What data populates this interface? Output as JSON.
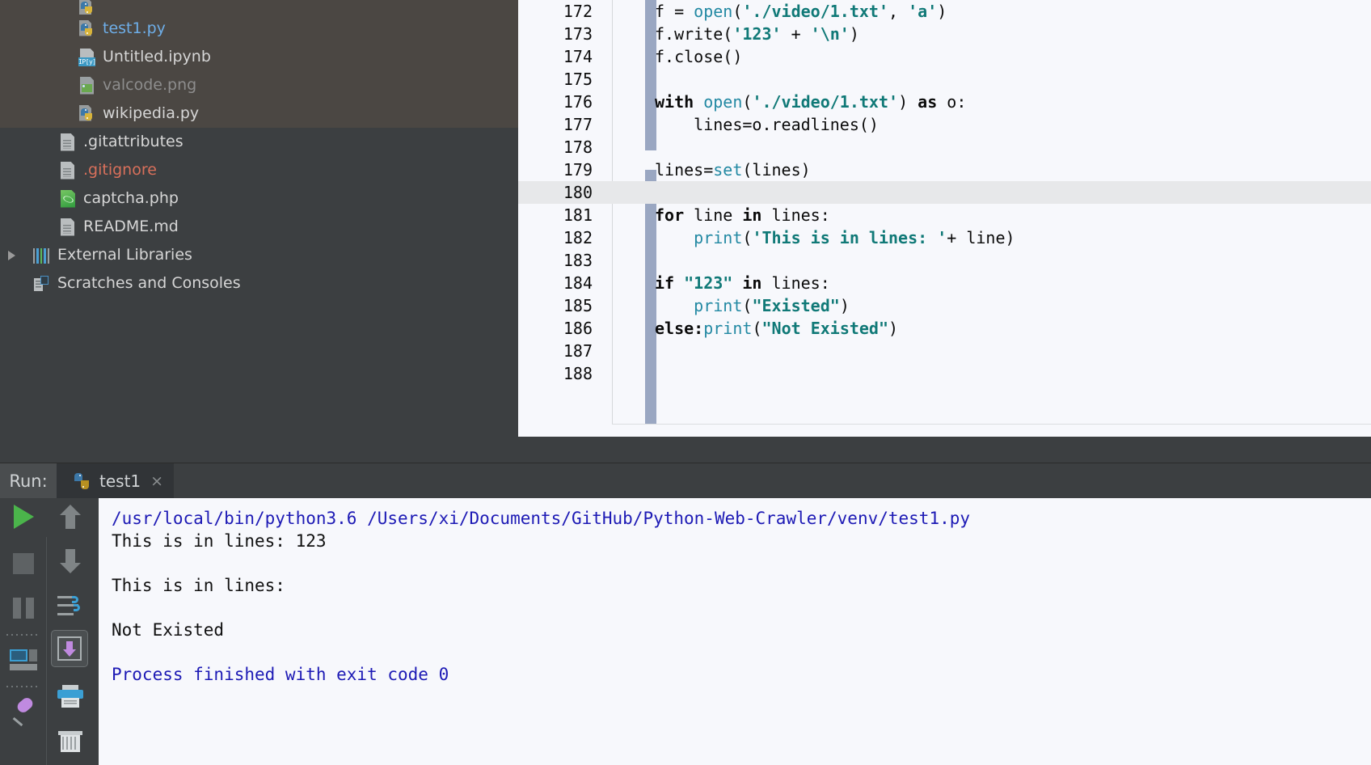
{
  "project_tree": {
    "items": [
      {
        "label": "",
        "icon": "python-file-icon",
        "state": "partial-top",
        "color": "#d6d6d6",
        "highlighted": true
      },
      {
        "label": "test1.py",
        "icon": "python-file-icon",
        "state": "normal",
        "color": "#6eaee8",
        "highlighted": true
      },
      {
        "label": "Untitled.ipynb",
        "icon": "jupyter-notebook-icon",
        "state": "normal",
        "color": "#d6d6d6",
        "highlighted": true
      },
      {
        "label": "valcode.png",
        "icon": "image-file-icon",
        "state": "dimmed",
        "color": "#8d8d8d",
        "highlighted": true
      },
      {
        "label": "wikipedia.py",
        "icon": "python-file-icon",
        "state": "normal",
        "color": "#d6d6d6",
        "highlighted": true
      },
      {
        "label": ".gitattributes",
        "icon": "text-file-icon",
        "state": "normal",
        "color": "#d6d6d6",
        "highlighted": false
      },
      {
        "label": ".gitignore",
        "icon": "text-file-icon",
        "state": "ignored",
        "color": "#d9705b",
        "highlighted": false
      },
      {
        "label": "captcha.php",
        "icon": "php-file-icon",
        "state": "normal",
        "color": "#d6d6d6",
        "highlighted": false
      },
      {
        "label": "README.md",
        "icon": "text-file-icon",
        "state": "normal",
        "color": "#d6d6d6",
        "highlighted": false
      },
      {
        "label": "External Libraries",
        "icon": "libraries-icon",
        "state": "collapsed-node",
        "color": "#d6d6d6",
        "highlighted": false
      },
      {
        "label": "Scratches and Consoles",
        "icon": "scratches-icon",
        "state": "node",
        "color": "#d6d6d6",
        "highlighted": false
      }
    ]
  },
  "editor": {
    "current_line": 180,
    "first_line": 172,
    "last_line": 188,
    "lines": [
      {
        "number": "172",
        "tokens": [
          {
            "t": "f = ",
            "c": "plain"
          },
          {
            "t": "open",
            "c": "fn"
          },
          {
            "t": "(",
            "c": "plain"
          },
          {
            "t": "'./video/1.txt'",
            "c": "str"
          },
          {
            "t": ", ",
            "c": "plain"
          },
          {
            "t": "'a'",
            "c": "str"
          },
          {
            "t": ")",
            "c": "plain"
          }
        ]
      },
      {
        "number": "173",
        "tokens": [
          {
            "t": "f.write(",
            "c": "plain"
          },
          {
            "t": "'123'",
            "c": "str"
          },
          {
            "t": " + ",
            "c": "plain"
          },
          {
            "t": "'\\n'",
            "c": "str"
          },
          {
            "t": ")",
            "c": "plain"
          }
        ]
      },
      {
        "number": "174",
        "tokens": [
          {
            "t": "f.close()",
            "c": "plain"
          }
        ]
      },
      {
        "number": "175",
        "tokens": []
      },
      {
        "number": "176",
        "tokens": [
          {
            "t": "with ",
            "c": "kw"
          },
          {
            "t": "open",
            "c": "fn"
          },
          {
            "t": "(",
            "c": "plain"
          },
          {
            "t": "'./video/1.txt'",
            "c": "str"
          },
          {
            "t": ") ",
            "c": "plain"
          },
          {
            "t": "as ",
            "c": "kw"
          },
          {
            "t": "o:",
            "c": "plain"
          }
        ]
      },
      {
        "number": "177",
        "tokens": [
          {
            "t": "    lines=o.readlines()",
            "c": "plain"
          }
        ]
      },
      {
        "number": "178",
        "tokens": []
      },
      {
        "number": "179",
        "tokens": [
          {
            "t": "lines=",
            "c": "plain"
          },
          {
            "t": "set",
            "c": "fn"
          },
          {
            "t": "(lines)",
            "c": "plain"
          }
        ]
      },
      {
        "number": "180",
        "tokens": []
      },
      {
        "number": "181",
        "tokens": [
          {
            "t": "for ",
            "c": "kw"
          },
          {
            "t": "line ",
            "c": "plain"
          },
          {
            "t": "in ",
            "c": "kw"
          },
          {
            "t": "lines:",
            "c": "plain"
          }
        ]
      },
      {
        "number": "182",
        "tokens": [
          {
            "t": "    ",
            "c": "plain"
          },
          {
            "t": "print",
            "c": "fn"
          },
          {
            "t": "(",
            "c": "plain"
          },
          {
            "t": "'This is in lines: '",
            "c": "str"
          },
          {
            "t": "+ line)",
            "c": "plain"
          }
        ]
      },
      {
        "number": "183",
        "tokens": []
      },
      {
        "number": "184",
        "tokens": [
          {
            "t": "if ",
            "c": "kw"
          },
          {
            "t": "\"123\" ",
            "c": "str"
          },
          {
            "t": "in ",
            "c": "kw"
          },
          {
            "t": "lines:",
            "c": "plain"
          }
        ]
      },
      {
        "number": "185",
        "tokens": [
          {
            "t": "    ",
            "c": "plain"
          },
          {
            "t": "print",
            "c": "fn"
          },
          {
            "t": "(",
            "c": "plain"
          },
          {
            "t": "\"Existed\"",
            "c": "str"
          },
          {
            "t": ")",
            "c": "plain"
          }
        ]
      },
      {
        "number": "186",
        "tokens": [
          {
            "t": "else:",
            "c": "kw"
          },
          {
            "t": "print",
            "c": "fn"
          },
          {
            "t": "(",
            "c": "plain"
          },
          {
            "t": "\"Not Existed\"",
            "c": "str"
          },
          {
            "t": ")",
            "c": "plain"
          }
        ]
      },
      {
        "number": "187",
        "tokens": []
      },
      {
        "number": "188",
        "tokens": []
      }
    ]
  },
  "run_panel": {
    "label": "Run:",
    "tab_name": "test1",
    "tab_close": "×",
    "toolbar_left": [
      {
        "name": "rerun-button",
        "icon": "play-icon"
      },
      {
        "name": "stop-button",
        "icon": "stop-icon"
      },
      {
        "name": "pause-output-button",
        "icon": "pause-icon"
      },
      {
        "name": "toggle-console-button",
        "icon": "console-icon"
      },
      {
        "name": "pin-tab-button",
        "icon": "pin-icon"
      }
    ],
    "toolbar_right": [
      {
        "name": "up-stacktrace-button",
        "icon": "arrow-up-icon"
      },
      {
        "name": "down-stacktrace-button",
        "icon": "arrow-down-icon"
      },
      {
        "name": "soft-wrap-button",
        "icon": "soft-wrap-icon"
      },
      {
        "name": "scroll-to-end-button",
        "icon": "scroll-to-end-icon",
        "selected": true
      },
      {
        "name": "print-button",
        "icon": "printer-icon"
      },
      {
        "name": "clear-all-button",
        "icon": "trash-icon"
      }
    ],
    "console_output": [
      {
        "text": "/usr/local/bin/python3.6 /Users/xi/Documents/GitHub/Python-Web-Crawler/venv/test1.py",
        "style": "blue"
      },
      {
        "text": "This is in lines: 123",
        "style": "plain"
      },
      {
        "text": "",
        "style": "plain"
      },
      {
        "text": "This is in lines:",
        "style": "plain"
      },
      {
        "text": "",
        "style": "plain"
      },
      {
        "text": "Not Existed",
        "style": "plain"
      },
      {
        "text": "",
        "style": "plain"
      },
      {
        "text": "Process finished with exit code 0",
        "style": "blue"
      }
    ]
  },
  "colors": {
    "panel_bg": "#3c3f41",
    "tree_selection_bg": "#4b4743",
    "editor_bg": "#f7f8fc",
    "current_line_bg": "#e7e8ea",
    "vcs_marker": "#9aa7c2",
    "string_token": "#107977",
    "function_token": "#2389a3",
    "console_blue": "#1d1ab5",
    "ignored_file": "#d9705b",
    "selected_file": "#6eaee8"
  }
}
